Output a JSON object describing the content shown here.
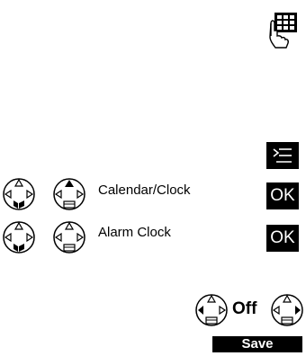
{
  "rows": [
    {
      "label": "Calendar/Clock",
      "key": "OK"
    },
    {
      "label": "Alarm Clock",
      "key": "OK"
    }
  ],
  "value_display": "Off",
  "softkey_save": "Save",
  "icons": {
    "keypad": "keypad-hand-icon",
    "menu": "menu-key-icon",
    "nav_down": "nav-key-down-icon",
    "nav_up": "nav-key-up-icon",
    "nav_left_right": "nav-key-left-right-icon"
  }
}
